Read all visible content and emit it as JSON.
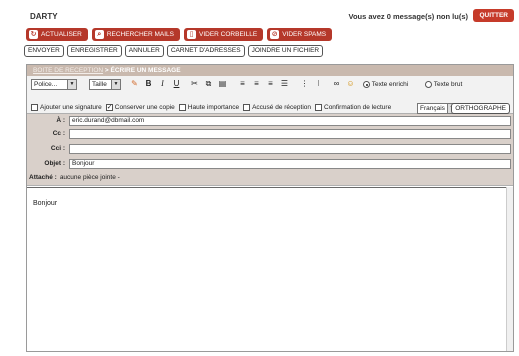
{
  "header": {
    "brand": "DARTY",
    "messages": "Vous avez 0 message(s) non lu(s)",
    "quit": "QUITTER"
  },
  "toolbar": [
    {
      "label": "ACTUALISER",
      "icon": "refresh-icon"
    },
    {
      "label": "RECHERCHER MAILS",
      "icon": "search-icon"
    },
    {
      "label": "VIDER CORBEILLE",
      "icon": "trash-icon"
    },
    {
      "label": "VIDER SPAMS",
      "icon": "spam-icon"
    }
  ],
  "actions": [
    "ENVOYER",
    "ENREGISTRER",
    "ANNULER",
    "CARNET D'ADRESSES",
    "JOINDRE UN FICHIER"
  ],
  "compose": {
    "breadcrumb": "BOITE DE RECEPTION",
    "title": "> ÉCRIRE UN MESSAGE",
    "font": "Police...",
    "size": "Taille",
    "mode_rich": "Texte enrichi",
    "mode_plain": "Texte brut",
    "opt_signature": "Ajouter une signature",
    "opt_copy": "Conserver une copie",
    "opt_priority": "Haute importance",
    "opt_receipt": "Accusé de réception",
    "opt_confirm": "Confirmation de lecture",
    "language": "Français",
    "spellcheck": "ORTHOGRAPHE"
  },
  "fields": {
    "to_label": "À :",
    "to": "eric.durand@dbmail.com",
    "cc_label": "Cc :",
    "cc": "",
    "bcc_label": "Cci :",
    "bcc": "",
    "subject_label": "Objet :",
    "subject": "Bonjour",
    "attach_label": "Attaché :",
    "attach": "aucune pièce jointe -"
  },
  "body_text": "Bonjour",
  "colors": {
    "accent": "#b5382a",
    "titlebar": "#c9b9ae",
    "address_bg": "#d9d0ca"
  }
}
